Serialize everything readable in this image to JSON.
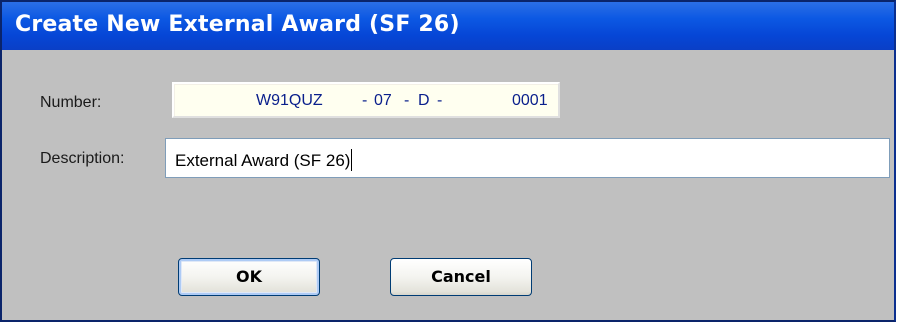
{
  "window": {
    "title": "Create New External Award (SF 26)"
  },
  "form": {
    "number_label": "Number:",
    "number": {
      "prefix": "W91QUZ",
      "sep1": "-",
      "year": "07",
      "sep2": "-",
      "type": "D",
      "sep3": "-",
      "serial": "0001"
    },
    "description_label": "Description:",
    "description_value": "External Award (SF 26)"
  },
  "buttons": {
    "ok": "OK",
    "cancel": "Cancel"
  },
  "colors": {
    "title_bar": "#0c58e3",
    "dialog_bg": "#c0c0c0",
    "number_text": "#0a1f8c"
  }
}
